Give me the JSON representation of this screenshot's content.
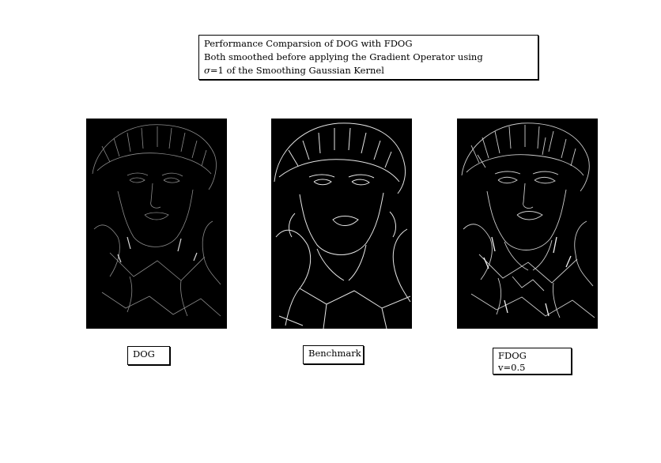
{
  "caption": {
    "line1": "Performance Comparsion of DOG with FDOG",
    "line2": "Both smoothed before applying the Gradient Operator using",
    "line3_sigma": "σ",
    "line3_rest": "=1 of the Smoothing Gaussian Kernel"
  },
  "panels": [
    {
      "id": "dog",
      "label": "DOG"
    },
    {
      "id": "bench",
      "label": "Benchmark"
    },
    {
      "id": "fdog",
      "label": "FDOG",
      "sublabel": "v=0.5"
    }
  ],
  "colors": {
    "background": "#ffffff",
    "panel": "#000000",
    "edge": "#ffffff"
  }
}
